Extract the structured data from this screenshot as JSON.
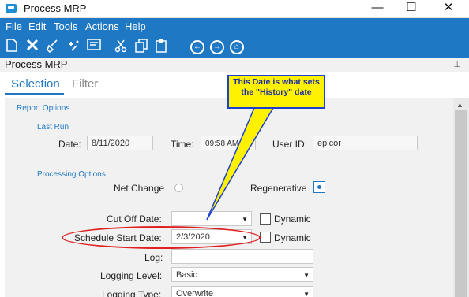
{
  "window": {
    "title": "Process MRP",
    "controls": {
      "minimize": "—",
      "maximize": "☐",
      "close": "✕"
    }
  },
  "menu": [
    "File",
    "Edit",
    "Tools",
    "Actions",
    "Help"
  ],
  "toolbar_icons": [
    "new-icon",
    "delete-icon",
    "clear-icon",
    "sparkle-icon",
    "print-preview-icon",
    "cut-icon",
    "copy-icon",
    "paste-icon",
    "back-icon",
    "forward-icon",
    "home-icon"
  ],
  "panel": {
    "title": "Process MRP"
  },
  "tabs": {
    "selection": "Selection",
    "filter": "Filter"
  },
  "form": {
    "report_options_label": "Report Options",
    "last_run": {
      "section_label": "Last Run",
      "date_label": "Date:",
      "date_value": "8/11/2020",
      "time_label": "Time:",
      "time_value": "09:58 AM",
      "user_label": "User ID:",
      "user_value": "epicor"
    },
    "processing": {
      "section_label": "Processing Options",
      "net_change_label": "Net Change",
      "regenerative_label": "Regenerative",
      "selected": "Regenerative",
      "cutoff_label": "Cut Off Date:",
      "cutoff_value": "",
      "dynamic_label": "Dynamic",
      "schedule_start_label": "Schedule Start Date:",
      "schedule_start_value": "2/3/2020",
      "log_label": "Log:",
      "log_value": "",
      "logging_level_label": "Logging Level:",
      "logging_level_value": "Basic",
      "logging_type_label": "Logging Type:",
      "logging_type_value": "Overwrite"
    }
  },
  "annotation": {
    "callout_text": "This Date is what sets the \"History\" date",
    "callout_color": "#fff200",
    "callout_border": "#1f3fd1",
    "ellipse_color": "#e02020"
  }
}
